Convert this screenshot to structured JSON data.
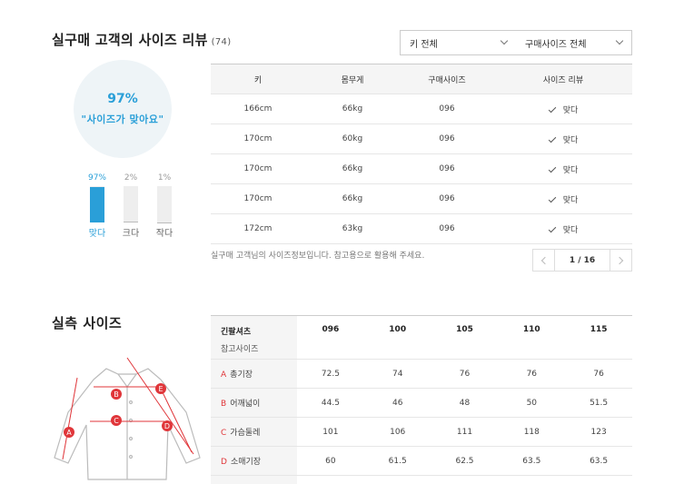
{
  "review": {
    "title": "실구매 고객의 사이즈 리뷰",
    "count": "(74)",
    "filters": [
      {
        "label": "키 전체"
      },
      {
        "label": "구매사이즈 전체"
      }
    ],
    "summary": {
      "percent": "97%",
      "message": "\"사이즈가 맞아요\""
    },
    "bars": [
      {
        "percent_label": "97%",
        "value": 0.97,
        "label": "맞다",
        "active": true
      },
      {
        "percent_label": "2%",
        "value": 0.02,
        "label": "크다",
        "active": false
      },
      {
        "percent_label": "1%",
        "value": 0.01,
        "label": "작다",
        "active": false
      }
    ],
    "table": {
      "headers": [
        "키",
        "몸무게",
        "구매사이즈",
        "사이즈 리뷰"
      ],
      "rows": [
        [
          "166cm",
          "66kg",
          "096",
          "맞다"
        ],
        [
          "170cm",
          "60kg",
          "096",
          "맞다"
        ],
        [
          "170cm",
          "66kg",
          "096",
          "맞다"
        ],
        [
          "170cm",
          "66kg",
          "096",
          "맞다"
        ],
        [
          "172cm",
          "63kg",
          "096",
          "맞다"
        ]
      ]
    },
    "note": "실구매 고객님의 사이즈정보입니다. 참고용으로 활용해 주세요.",
    "pager": {
      "current": "1",
      "total": "16",
      "text": "1 / 16"
    }
  },
  "measure": {
    "title": "실측 사이즈",
    "header": {
      "name": "긴팔셔츠",
      "sub": "참고사이즈",
      "sizes": [
        "096",
        "100",
        "105",
        "110",
        "115"
      ]
    },
    "rows": [
      {
        "letter": "A",
        "name": "총기장",
        "values": [
          "72.5",
          "74",
          "76",
          "76",
          "76"
        ]
      },
      {
        "letter": "B",
        "name": "어깨넓이",
        "values": [
          "44.5",
          "46",
          "48",
          "50",
          "51.5"
        ]
      },
      {
        "letter": "C",
        "name": "가슴둘레",
        "values": [
          "101",
          "106",
          "111",
          "118",
          "123"
        ]
      },
      {
        "letter": "D",
        "name": "소매기장",
        "values": [
          "60",
          "61.5",
          "62.5",
          "63.5",
          "63.5"
        ]
      }
    ],
    "diagram_labels": [
      "A",
      "B",
      "C",
      "D",
      "E"
    ],
    "accent_color": "#e0363a"
  },
  "colors": {
    "primary": "#2a9fd8",
    "accent": "#e0363a"
  }
}
